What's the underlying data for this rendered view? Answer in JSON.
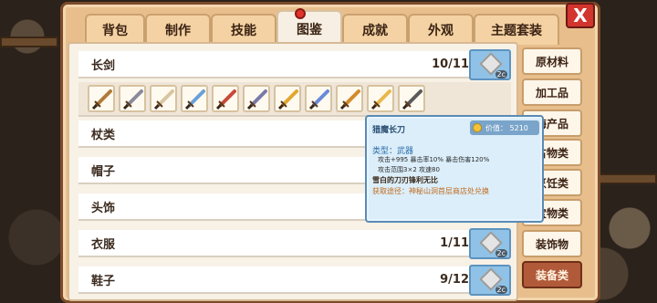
{
  "tabs": [
    {
      "label": "背包"
    },
    {
      "label": "制作"
    },
    {
      "label": "技能"
    },
    {
      "label": "图鉴"
    },
    {
      "label": "成就"
    },
    {
      "label": "外观"
    },
    {
      "label": "主题套装"
    }
  ],
  "close_label": "X",
  "rows": [
    {
      "label": "长剑",
      "count": "10/11",
      "badge_level": "2c"
    },
    {
      "label": "杖类",
      "count": "",
      "badge_level": ""
    },
    {
      "label": "帽子",
      "count": "",
      "badge_level": ""
    },
    {
      "label": "头饰",
      "count": "",
      "badge_level": ""
    },
    {
      "label": "衣服",
      "count": "1/11",
      "badge_level": "2c"
    },
    {
      "label": "鞋子",
      "count": "9/12",
      "badge_level": "2c"
    }
  ],
  "sword_items": [
    {
      "icon": "bronze-sword-icon",
      "color": "#b07a3a"
    },
    {
      "icon": "iron-sword-icon",
      "color": "#8a8a9a"
    },
    {
      "icon": "bone-sword-icon",
      "color": "#d8c6a0"
    },
    {
      "icon": "crystal-sword-icon",
      "color": "#6aa0d8"
    },
    {
      "icon": "ruby-sword-icon",
      "color": "#c84a3a"
    },
    {
      "icon": "steel-sword-icon",
      "color": "#7a7aa8"
    },
    {
      "icon": "golden-sword-icon",
      "color": "#e0a832"
    },
    {
      "icon": "frost-sword-icon",
      "color": "#6a8ad8"
    },
    {
      "icon": "amber-sword-icon",
      "color": "#d48a2a"
    },
    {
      "icon": "crescent-blade-icon",
      "color": "#e8b84a"
    },
    {
      "icon": "shadow-blade-icon",
      "color": "#5a5a5a"
    }
  ],
  "categories": [
    {
      "label": "原材料"
    },
    {
      "label": "加工品"
    },
    {
      "label": "海产品"
    },
    {
      "label": "古物类"
    },
    {
      "label": "烹饪类"
    },
    {
      "label": "宝物类"
    },
    {
      "label": "装饰物"
    },
    {
      "label": "装备类"
    }
  ],
  "tooltip": {
    "title": "猎魔长刀",
    "price": "价值：  5210",
    "type": "类型：武器",
    "stats1": "攻击+995   暴击率10%   暴击伤害120%",
    "stats2": "攻击范围3×2   攻速80",
    "desc": "雪白的刀刃锋利无比",
    "source": "获取途径：神秘山洞首层商店处兑换"
  },
  "colors": {
    "window_bg": "#e8bf8c",
    "active_category": "#b05a3a",
    "badge_blue": "#8fc2e6",
    "close_red": "#d1352d"
  }
}
